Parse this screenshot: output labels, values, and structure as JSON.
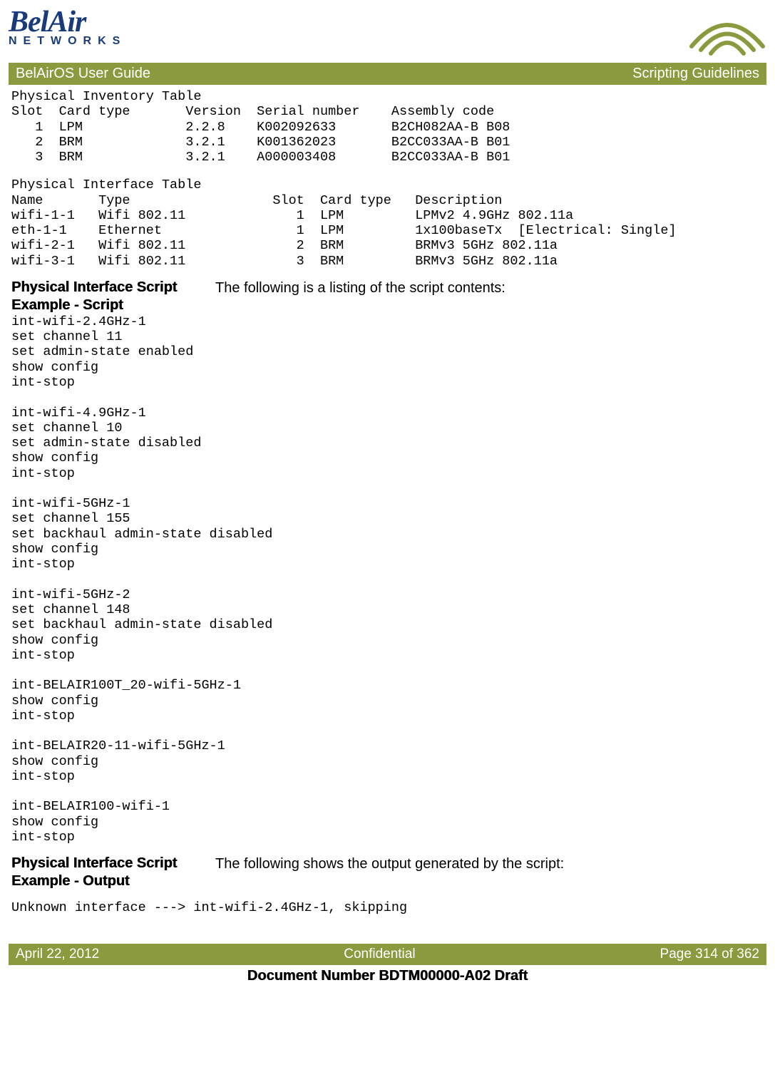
{
  "header": {
    "logo_top": "BelAir",
    "logo_bottom": "NETWORKS",
    "title_left": "BelAirOS User Guide",
    "title_right": "Scripting Guidelines"
  },
  "inventory_table": "Physical Inventory Table\nSlot  Card type       Version  Serial number    Assembly code\n   1  LPM             2.2.8    K002092633       B2CH082AA-B B08\n   2  BRM             3.2.1    K001362023       B2CC033AA-B B01\n   3  BRM             3.2.1    A000003408       B2CC033AA-B B01",
  "interface_table": "Physical Interface Table\nName       Type                  Slot  Card type   Description\nwifi-1-1   Wifi 802.11              1  LPM         LPMv2 4.9GHz 802.11a\neth-1-1    Ethernet                 1  LPM         1x100baseTx  [Electrical: Single]\nwifi-2-1   Wifi 802.11              2  BRM         BRMv3 5GHz 802.11a\nwifi-3-1   Wifi 802.11              3  BRM         BRMv3 5GHz 802.11a",
  "sections": {
    "script_heading": "Physical Interface Script Example - Script",
    "script_intro": "The following is a listing of the script contents:",
    "script_body": "int-wifi-2.4GHz-1\nset channel 11\nset admin-state enabled\nshow config\nint-stop\n\nint-wifi-4.9GHz-1\nset channel 10\nset admin-state disabled\nshow config\nint-stop\n\nint-wifi-5GHz-1\nset channel 155\nset backhaul admin-state disabled\nshow config\nint-stop\n\nint-wifi-5GHz-2\nset channel 148\nset backhaul admin-state disabled\nshow config\nint-stop\n\nint-BELAIR100T_20-wifi-5GHz-1\nshow config\nint-stop\n\nint-BELAIR20-11-wifi-5GHz-1\nshow config\nint-stop\n\nint-BELAIR100-wifi-1\nshow config\nint-stop",
    "output_heading": "Physical Interface Script Example - Output",
    "output_intro": "The following shows the output generated by the script:",
    "output_body": "Unknown interface ---> int-wifi-2.4GHz-1, skipping"
  },
  "footer": {
    "left": "April 22, 2012",
    "center": "Confidential",
    "right": "Page 314 of 362",
    "doc_number": "Document Number BDTM00000-A02 Draft"
  }
}
